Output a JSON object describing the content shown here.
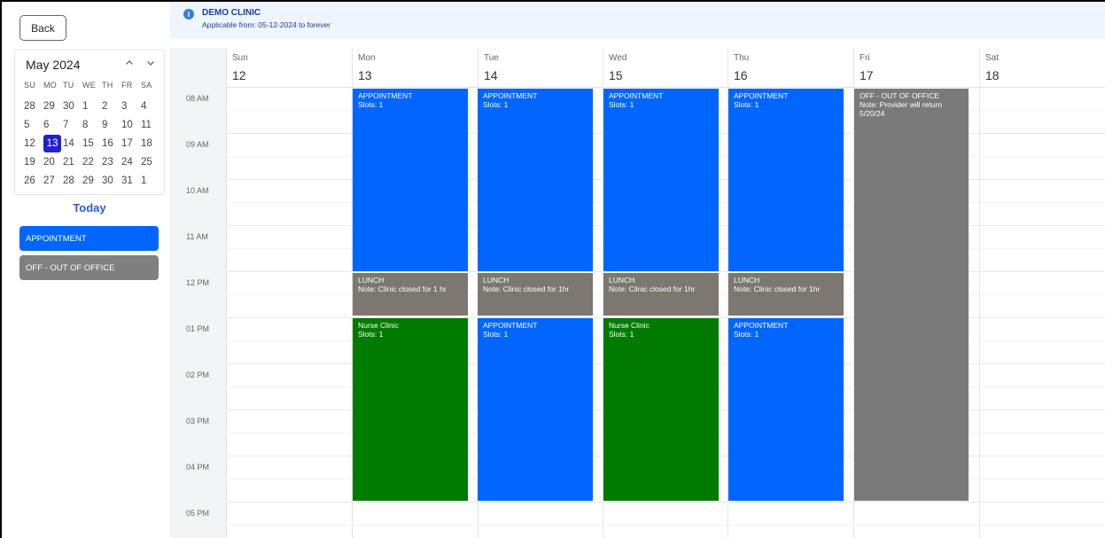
{
  "sidebar": {
    "back_label": "Back",
    "month_label": "May 2024",
    "prev_icon": "chevron-up",
    "next_icon": "chevron-down",
    "weekdays": [
      "SU",
      "MO",
      "TU",
      "WE",
      "TH",
      "FR",
      "SA"
    ],
    "weeks": [
      [
        "28",
        "29",
        "30",
        "1",
        "2",
        "3",
        "4"
      ],
      [
        "5",
        "6",
        "7",
        "8",
        "9",
        "10",
        "11"
      ],
      [
        "12",
        "13",
        "14",
        "15",
        "16",
        "17",
        "18"
      ],
      [
        "19",
        "20",
        "21",
        "22",
        "23",
        "24",
        "25"
      ],
      [
        "26",
        "27",
        "28",
        "29",
        "30",
        "31",
        "1"
      ]
    ],
    "selected_day": "13",
    "today_label": "Today",
    "legend": [
      {
        "label": "APPOINTMENT",
        "color": "#0066ff"
      },
      {
        "label": "OFF - OUT OF OFFICE",
        "color": "#7f7f7f"
      }
    ]
  },
  "banner": {
    "icon": "info-icon",
    "title": "DEMO CLINIC",
    "subtitle": "Applicable from: 05-12-2024 to forever"
  },
  "calendar": {
    "days": [
      {
        "name": "Sun",
        "date": "12"
      },
      {
        "name": "Mon",
        "date": "13"
      },
      {
        "name": "Tue",
        "date": "14"
      },
      {
        "name": "Wed",
        "date": "15"
      },
      {
        "name": "Thu",
        "date": "16"
      },
      {
        "name": "Fri",
        "date": "17"
      },
      {
        "name": "Sat",
        "date": "18"
      }
    ],
    "times": [
      "08 AM",
      "09 AM",
      "10 AM",
      "11 AM",
      "12 PM",
      "01 PM",
      "02 PM",
      "03 PM",
      "04 PM",
      "05 PM"
    ],
    "events": {
      "mon_appt": {
        "title": "APPOINTMENT",
        "detail": "Slots: 1"
      },
      "tue_appt": {
        "title": "APPOINTMENT",
        "detail": "Slots: 1"
      },
      "wed_appt": {
        "title": "APPOINTMENT",
        "detail": "Slots: 1"
      },
      "thu_appt": {
        "title": "APPOINTMENT",
        "detail": "Slots: 1"
      },
      "fri_off": {
        "title": "OFF - OUT OF OFFICE",
        "detail": "Note: Provider will return",
        "detail2": "5/20/24"
      },
      "mon_lunch": {
        "title": "LUNCH",
        "detail": "Note: Clinic closed for 1 hr"
      },
      "tue_lunch": {
        "title": "LUNCH",
        "detail": "Note: Clinic closed for 1hr"
      },
      "wed_lunch": {
        "title": "LUNCH",
        "detail": "Note: Clinic closed for 1hr"
      },
      "thu_lunch": {
        "title": "LUNCH",
        "detail": "Note: Clinic closed for 1hr"
      },
      "mon_nurse": {
        "title": "Nurse Clinic",
        "detail": "Slots: 1"
      },
      "tue_appt2": {
        "title": "APPOINTMENT",
        "detail": "Slots: 1"
      },
      "wed_nurse": {
        "title": "Nurse Clinic",
        "detail": "Slots: 1"
      },
      "thu_appt2": {
        "title": "APPOINTMENT",
        "detail": "Slots: 1"
      }
    },
    "colors": {
      "appointment": "#0066ff",
      "lunch": "#7a7870",
      "nurse": "#007a00",
      "off": "#7a7a7a"
    }
  }
}
